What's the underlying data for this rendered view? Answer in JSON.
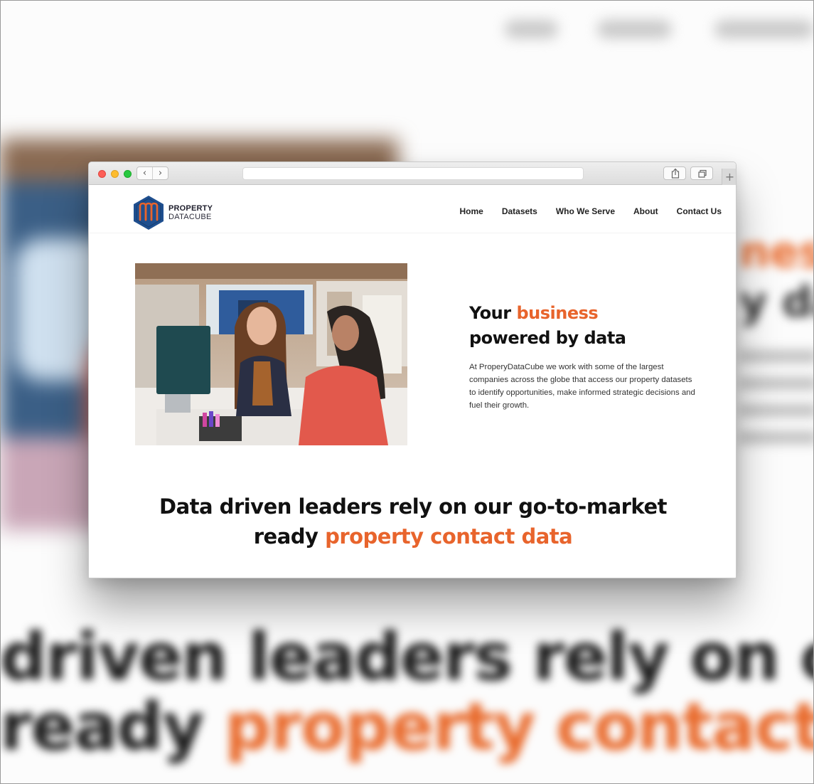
{
  "background": {
    "nav_placeholders": 3,
    "hero_line1_accent": "ness",
    "hero_line2": "y da",
    "big_line1": "driven leaders rely on our go-to-",
    "big_line2_plain": "ready",
    "big_line2_accent": "property contact data"
  },
  "browser": {
    "back_label": "‹",
    "forward_label": "›",
    "new_tab_label": "+"
  },
  "site": {
    "logo": {
      "line1": "PROPERTY",
      "line2": "DATACUBE"
    },
    "nav": [
      "Home",
      "Datasets",
      "Who We Serve",
      "About",
      "Contact Us"
    ],
    "hero": {
      "title_part1": "Your",
      "title_accent": "business",
      "title_part2": "powered by data",
      "paragraph": "At ProperyDataCube we work with some of the largest companies across the globe that access our property datasets to identify opportunities, make informed strategic decisions and fuel their growth."
    },
    "section": {
      "heading_line1": "Data driven leaders rely on our go-to-market",
      "heading_plain": "ready",
      "heading_accent": "property contact data"
    }
  },
  "colors": {
    "accent": "#e8642c",
    "logo_blue": "#1f4f8f",
    "logo_orange": "#e8642c"
  }
}
